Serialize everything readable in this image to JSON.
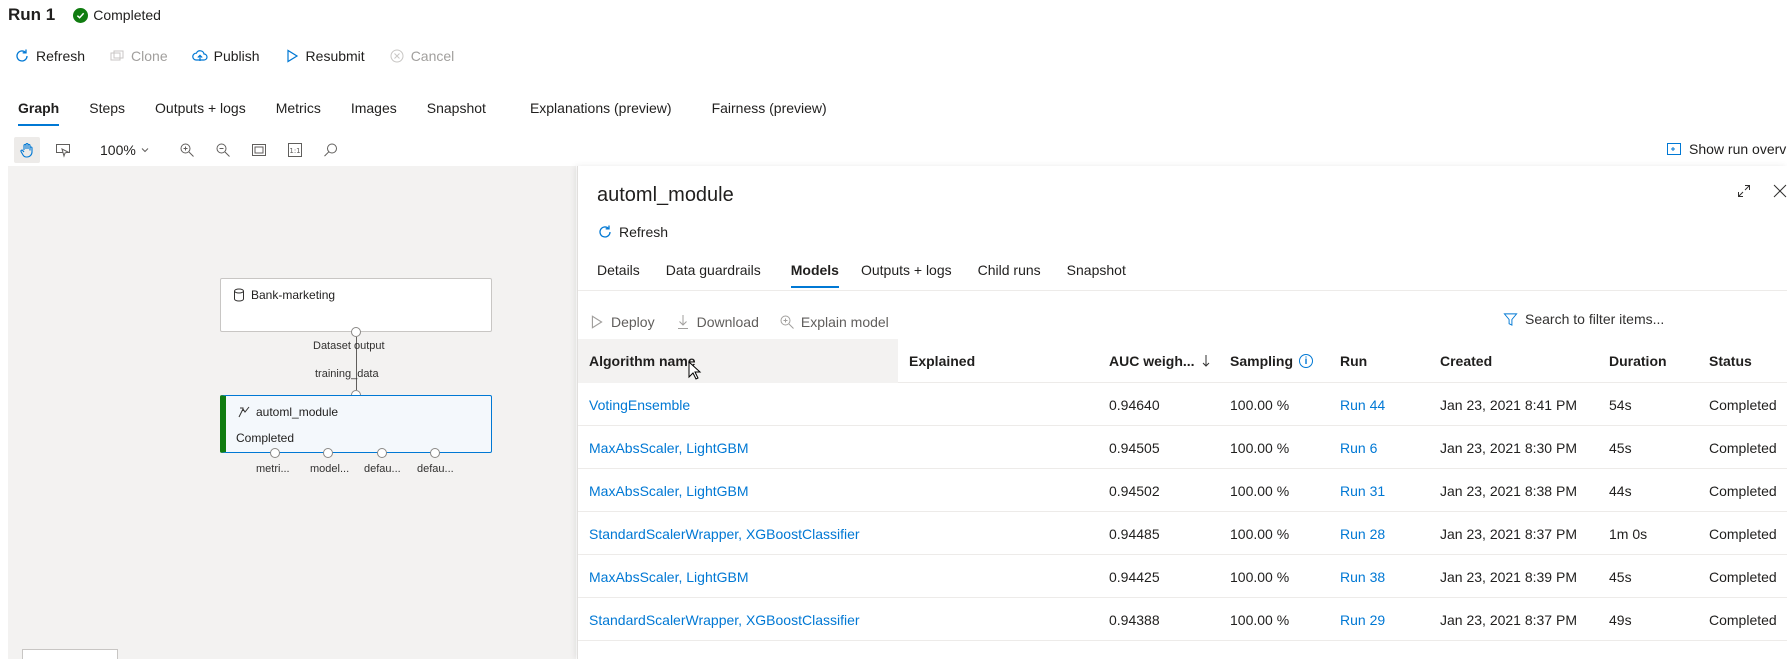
{
  "run": {
    "title": "Run 1",
    "status": "Completed"
  },
  "commands": [
    {
      "label": "Refresh",
      "icon": "refresh-icon",
      "enabled": true
    },
    {
      "label": "Clone",
      "icon": "clone-icon",
      "enabled": false
    },
    {
      "label": "Publish",
      "icon": "publish-cloud-icon",
      "enabled": true
    },
    {
      "label": "Resubmit",
      "icon": "play-icon",
      "enabled": true
    },
    {
      "label": "Cancel",
      "icon": "cancel-icon",
      "enabled": false
    }
  ],
  "tabs": [
    "Graph",
    "Steps",
    "Outputs + logs",
    "Metrics",
    "Images",
    "Snapshot",
    "Explanations (preview)",
    "Fairness (preview)"
  ],
  "active_tab": "Graph",
  "graph_toolbar": {
    "zoom": "100%",
    "show_overview": "Show run overv"
  },
  "graph": {
    "dataset_node": {
      "label": "Bank-marketing",
      "icon": "database-icon"
    },
    "edge_output_label": "Dataset output",
    "edge_input_label": "training_data",
    "module_node": {
      "label": "automl_module",
      "status": "Completed",
      "icon": "module-icon"
    },
    "output_ports": [
      "metri...",
      "model...",
      "defau...",
      "defau..."
    ]
  },
  "panel": {
    "title": "automl_module",
    "refresh_label": "Refresh",
    "tabs": [
      "Details",
      "Data guardrails",
      "Models",
      "Outputs + logs",
      "Child runs",
      "Snapshot"
    ],
    "active_tab": "Models",
    "actions": {
      "deploy": "Deploy",
      "download": "Download",
      "explain": "Explain model"
    },
    "filter_placeholder": "Search to filter items...",
    "columns": {
      "algorithm": "Algorithm name",
      "explained": "Explained",
      "auc": "AUC weigh...",
      "sampling": "Sampling",
      "run": "Run",
      "created": "Created",
      "duration": "Duration",
      "status": "Status"
    },
    "rows": [
      {
        "algorithm": "VotingEnsemble",
        "explained": "",
        "auc": "0.94640",
        "sampling": "100.00 %",
        "run": "Run 44",
        "created": "Jan 23, 2021 8:41 PM",
        "duration": "54s",
        "status": "Completed"
      },
      {
        "algorithm": "MaxAbsScaler, LightGBM",
        "explained": "",
        "auc": "0.94505",
        "sampling": "100.00 %",
        "run": "Run 6",
        "created": "Jan 23, 2021 8:30 PM",
        "duration": "45s",
        "status": "Completed"
      },
      {
        "algorithm": "MaxAbsScaler, LightGBM",
        "explained": "",
        "auc": "0.94502",
        "sampling": "100.00 %",
        "run": "Run 31",
        "created": "Jan 23, 2021 8:38 PM",
        "duration": "44s",
        "status": "Completed"
      },
      {
        "algorithm": "StandardScalerWrapper, XGBoostClassifier",
        "explained": "",
        "auc": "0.94485",
        "sampling": "100.00 %",
        "run": "Run 28",
        "created": "Jan 23, 2021 8:37 PM",
        "duration": "1m 0s",
        "status": "Completed"
      },
      {
        "algorithm": "MaxAbsScaler, LightGBM",
        "explained": "",
        "auc": "0.94425",
        "sampling": "100.00 %",
        "run": "Run 38",
        "created": "Jan 23, 2021 8:39 PM",
        "duration": "45s",
        "status": "Completed"
      },
      {
        "algorithm": "StandardScalerWrapper, XGBoostClassifier",
        "explained": "",
        "auc": "0.94388",
        "sampling": "100.00 %",
        "run": "Run 29",
        "created": "Jan 23, 2021 8:37 PM",
        "duration": "49s",
        "status": "Completed"
      }
    ]
  },
  "colors": {
    "accent": "#0078d4",
    "success": "#107c10",
    "canvas_bg": "#f3f2f1"
  }
}
